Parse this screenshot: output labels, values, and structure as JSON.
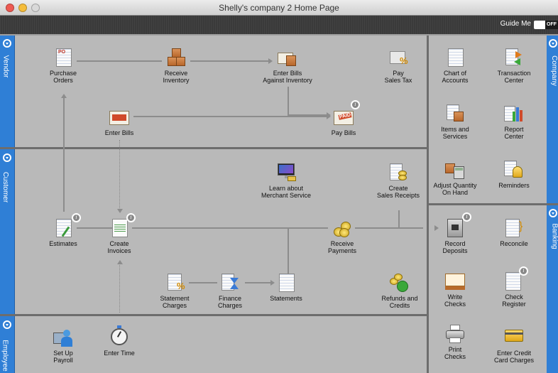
{
  "window": {
    "title": "Shelly's company 2 Home Page"
  },
  "toolbar": {
    "guide_label": "Guide Me",
    "toggle_label": "OFF"
  },
  "sections": {
    "vendor": "Vendor",
    "customer": "Customer",
    "employee": "Employee",
    "company": "Company",
    "banking": "Banking"
  },
  "vendor": {
    "purchase_orders": "Purchase\nOrders",
    "receive_inventory": "Receive\nInventory",
    "enter_bills_inventory": "Enter Bills\nAgainst Inventory",
    "pay_sales_tax": "Pay\nSales Tax",
    "enter_bills": "Enter Bills",
    "pay_bills": "Pay Bills"
  },
  "customer": {
    "learn_merchant": "Learn about\nMerchant Service",
    "create_sales_receipts": "Create\nSales Receipts",
    "estimates": "Estimates",
    "create_invoices": "Create\nInvoices",
    "receive_payments": "Receive\nPayments",
    "statement_charges": "Statement\nCharges",
    "finance_charges": "Finance\nCharges",
    "statements": "Statements",
    "refunds_credits": "Refunds and\nCredits"
  },
  "employee": {
    "setup_payroll": "Set Up\nPayroll",
    "enter_time": "Enter Time"
  },
  "company": {
    "chart_of_accounts": "Chart of\nAccounts",
    "transaction_center": "Transaction\nCenter",
    "items_services": "Items and\nServices",
    "report_center": "Report\nCenter",
    "adjust_quantity": "Adjust Quantity\nOn Hand",
    "reminders": "Reminders"
  },
  "banking": {
    "record_deposits": "Record\nDeposits",
    "reconcile": "Reconcile",
    "write_checks": "Write\nChecks",
    "check_register": "Check\nRegister",
    "print_checks": "Print\nChecks",
    "enter_credit_card": "Enter Credit\nCard Charges"
  },
  "icons": {
    "po_text": "PO",
    "paid_text": "PAID",
    "percent": "%",
    "info": "i"
  },
  "colors": {
    "accent": "#2f7fd6",
    "panel": "#b9b9b9"
  }
}
